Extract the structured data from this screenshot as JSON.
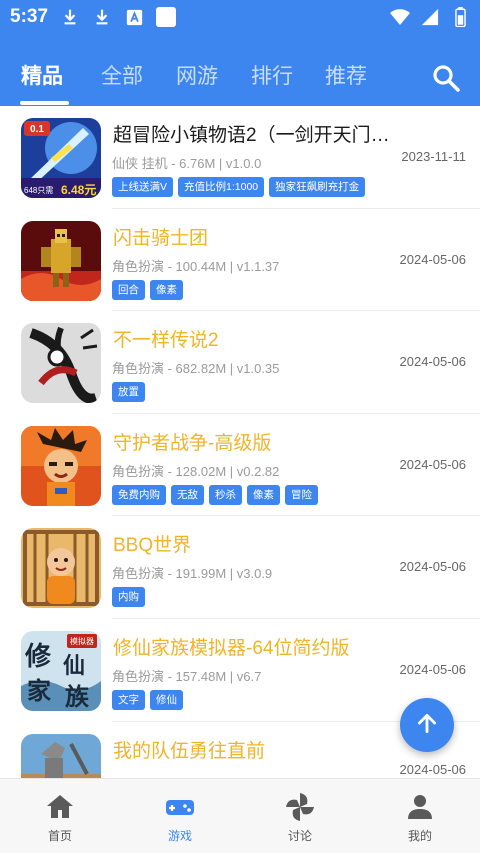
{
  "status_bar": {
    "time": "5:37",
    "icons": [
      "download-icon",
      "download-icon",
      "font-icon",
      "square-icon",
      "wifi-icon",
      "signal-icon",
      "battery-icon"
    ]
  },
  "tabs": [
    {
      "label": "精品",
      "active": true
    },
    {
      "label": "全部",
      "active": false
    },
    {
      "label": "网游",
      "active": false
    },
    {
      "label": "排行",
      "active": false
    },
    {
      "label": "推荐",
      "active": false
    }
  ],
  "games": [
    {
      "title": "超冒险小镇物语2（一剑开天门0....",
      "meta": "仙侠 挂机 - 6.76M | v1.0.0",
      "date": "2023-11-11",
      "title_color": "#1a1a1a",
      "tags": [
        "上线送满V",
        "充值比例1:1000",
        "独家狂飙刷充打金"
      ]
    },
    {
      "title": "闪击骑士团",
      "meta": "角色扮演 - 100.44M | v1.1.37",
      "date": "2024-05-06",
      "title_color": "#f0b429",
      "tags": [
        "回合",
        "像素"
      ]
    },
    {
      "title": "不一样传说2",
      "meta": "角色扮演 - 682.82M | v1.0.35",
      "date": "2024-05-06",
      "title_color": "#f0b429",
      "tags": [
        "放置"
      ]
    },
    {
      "title": "守护者战争-高级版",
      "meta": "角色扮演 - 128.02M | v0.2.82",
      "date": "2024-05-06",
      "title_color": "#f0b429",
      "tags": [
        "免费内购",
        "无敌",
        "秒杀",
        "像素",
        "冒险"
      ]
    },
    {
      "title": "BBQ世界",
      "meta": "角色扮演 - 191.99M | v3.0.9",
      "date": "2024-05-06",
      "title_color": "#f0b429",
      "tags": [
        "内购"
      ]
    },
    {
      "title": "修仙家族模拟器-64位简约版",
      "meta": "角色扮演 - 157.48M | v6.7",
      "date": "2024-05-06",
      "title_color": "#f0b429",
      "tags": [
        "文字",
        "修仙"
      ]
    },
    {
      "title": "我的队伍勇往直前",
      "meta": "",
      "date": "2024-05-06",
      "title_color": "#f0b429",
      "tags": []
    }
  ],
  "icon_text": {
    "game1_badge": "0.1",
    "game1_promo": "648只需",
    "game1_price": "6.48元",
    "game6_chars": [
      "修",
      "仙",
      "家",
      "族"
    ],
    "game6_stamp": "模拟器"
  },
  "bottom_nav": [
    {
      "label": "首页",
      "icon": "home-icon",
      "active": false
    },
    {
      "label": "游戏",
      "icon": "gamepad-icon",
      "active": true
    },
    {
      "label": "讨论",
      "icon": "pinwheel-icon",
      "active": false
    },
    {
      "label": "我的",
      "icon": "user-icon",
      "active": false
    }
  ],
  "colors": {
    "primary": "#3d86f0",
    "title_highlight": "#f0b429",
    "nav_bg": "#f7f7f7"
  }
}
